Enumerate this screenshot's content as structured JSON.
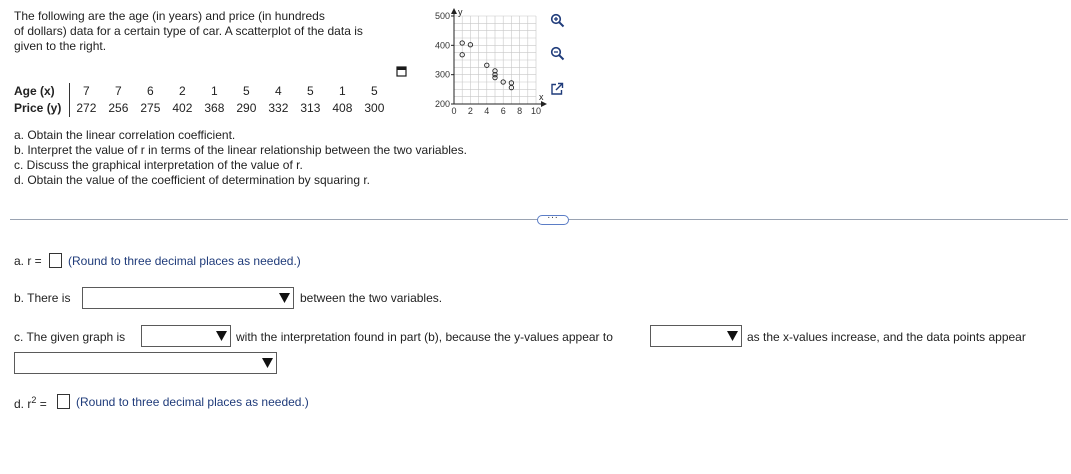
{
  "intro": {
    "line1": "The following are the age (in years) and price (in hundreds",
    "line2": "of dollars) data for a certain type of car. A scatterplot of the data is",
    "line3": "given to the right."
  },
  "table": {
    "age_label": "Age (x)",
    "price_label": "Price (y)",
    "ages": [
      "7",
      "7",
      "6",
      "2",
      "1",
      "5",
      "4",
      "5",
      "1",
      "5"
    ],
    "prices": [
      "272",
      "256",
      "275",
      "402",
      "368",
      "290",
      "332",
      "313",
      "408",
      "300"
    ]
  },
  "plot": {
    "y_axis_label": "y",
    "x_axis_label": "x",
    "y_ticks": [
      "500",
      "400",
      "300",
      "200"
    ],
    "x_ticks": [
      "0",
      "2",
      "4",
      "6",
      "8",
      "10"
    ]
  },
  "chart_data": {
    "type": "scatter",
    "x": [
      7,
      7,
      6,
      2,
      1,
      5,
      4,
      5,
      1,
      5
    ],
    "y": [
      272,
      256,
      275,
      402,
      368,
      290,
      332,
      313,
      408,
      300
    ],
    "xlabel": "x",
    "ylabel": "y",
    "xlim": [
      0,
      10
    ],
    "ylim": [
      200,
      500
    ],
    "grid": true
  },
  "questions": {
    "a": "a. Obtain the linear correlation coefficient.",
    "b": "b. Interpret the value of r in terms of the linear relationship between the two variables.",
    "c": "c. Discuss the graphical interpretation of the value of r.",
    "d": "d. Obtain the value of the coefficient of determination by squaring r."
  },
  "more_button": "...",
  "answers": {
    "a_prefix": "a. r =",
    "a_hint": "(Round to three decimal places as needed.)",
    "b_prefix": "b. There is",
    "b_suffix": "between the two variables.",
    "c_prefix": "c. The given graph is",
    "c_middle": "with the interpretation found in part (b), because the y-values appear to",
    "c_suffix": "as the x-values increase, and the data points appear",
    "d_prefix": "d. r",
    "d_sup": "2",
    "d_equals": "=",
    "d_hint": "(Round to three decimal places as needed.)"
  },
  "colors": {
    "accent": "#1f3b7a",
    "divider": "#9aa3b2",
    "more_border": "#5b7dc6"
  },
  "icons": {
    "copy": "copy-icon",
    "zoom_in": "zoom-in-icon",
    "zoom_out": "zoom-out-icon",
    "popout": "popout-icon",
    "dropdown_arrow": "caret-down-icon"
  }
}
